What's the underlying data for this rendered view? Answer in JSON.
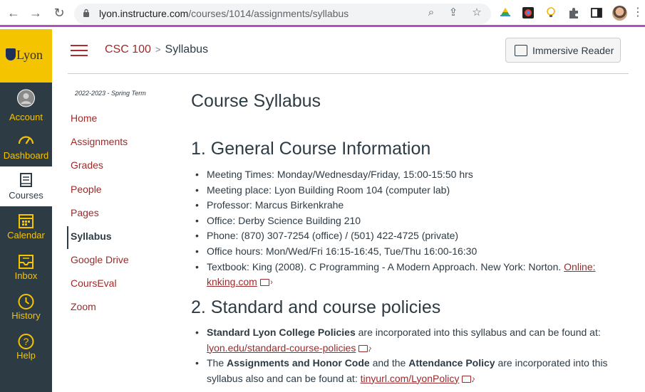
{
  "browser": {
    "url_host": "lyon.instructure.com",
    "url_path": "/courses/1014/assignments/syllabus"
  },
  "global_nav": {
    "logo": "Lyon",
    "items": [
      {
        "label": "Account",
        "icon": "account-icon"
      },
      {
        "label": "Dashboard",
        "icon": "dashboard-icon"
      },
      {
        "label": "Courses",
        "icon": "courses-icon"
      },
      {
        "label": "Calendar",
        "icon": "calendar-icon"
      },
      {
        "label": "Inbox",
        "icon": "inbox-icon"
      },
      {
        "label": "History",
        "icon": "history-icon"
      },
      {
        "label": "Help",
        "icon": "help-icon"
      }
    ]
  },
  "header": {
    "course": "CSC 100",
    "separator": ">",
    "page": "Syllabus",
    "immersive_reader": "Immersive Reader"
  },
  "course_nav": {
    "term": "2022-2023 - Spring Term",
    "items": [
      "Home",
      "Assignments",
      "Grades",
      "People",
      "Pages",
      "Syllabus",
      "Google Drive",
      "CoursEval",
      "Zoom"
    ],
    "active": "Syllabus"
  },
  "content": {
    "title": "Course Syllabus",
    "section1": {
      "heading": "1. General Course Information",
      "items": [
        "Meeting Times: Monday/Wednesday/Friday, 15:00-15:50 hrs",
        "Meeting place: Lyon Building Room 104 (computer lab)",
        "Professor: Marcus Birkenkrahe",
        "Office: Derby Science Building 210",
        "Phone: (870) 307-7254 (office) / (501) 422-4725 (private)",
        "Office hours: Mon/Wed/Fri 16:15-16:45, Tue/Thu 16:00-16:30"
      ],
      "textbook_text": "Textbook: King (2008). C Programming - A Modern Approach. New York: Norton. ",
      "textbook_link_1": "Online:",
      "textbook_link_2": "knking.com"
    },
    "section2": {
      "heading": "2. Standard and course policies",
      "p1_bold": "Standard Lyon College Policies",
      "p1_text": " are incorporated into this syllabus and can be found at: ",
      "p1_link": "lyon.edu/standard-course-policies",
      "p2_pre": "The ",
      "p2_bold1": "Assignments and Honor Code",
      "p2_mid": " and the ",
      "p2_bold2": "Attendance Policy",
      "p2_text": " are incorporated into this syllabus also and can be found at: ",
      "p2_link": "tinyurl.com/LyonPolicy",
      "period": "."
    }
  }
}
